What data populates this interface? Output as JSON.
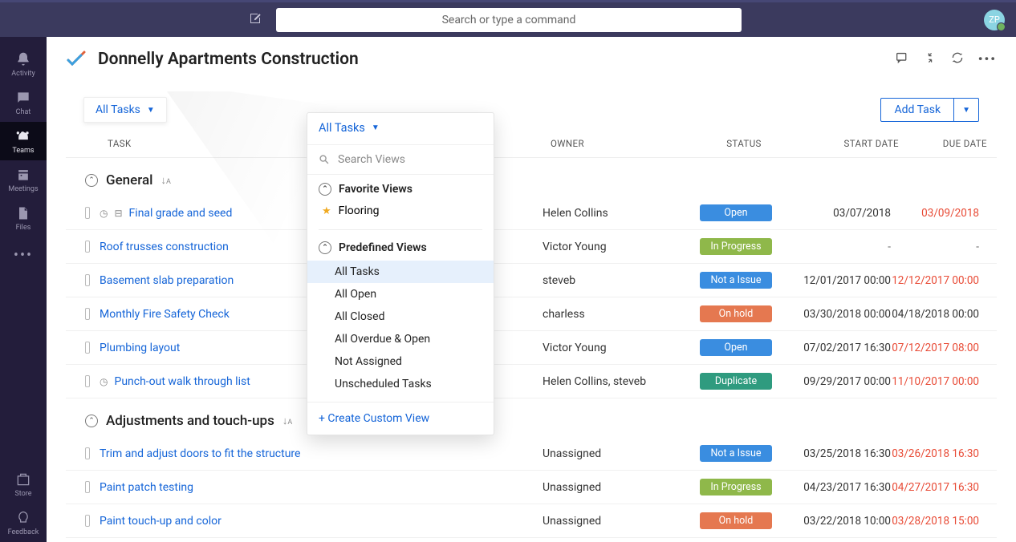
{
  "topbar": {
    "search_placeholder": "Search or type a command",
    "avatar_initials": "ZP"
  },
  "rail": {
    "activity": "Activity",
    "chat": "Chat",
    "teams": "Teams",
    "meetings": "Meetings",
    "files": "Files",
    "store": "Store",
    "feedback": "Feedback"
  },
  "header": {
    "title": "Donnelly Apartments Construction"
  },
  "toolbar": {
    "view_label": "All Tasks",
    "add_task_label": "Add Task"
  },
  "columns": {
    "task": "TASK",
    "owner": "OWNER",
    "status": "STATUS",
    "start": "START DATE",
    "due": "DUE DATE"
  },
  "sections": [
    {
      "name": "General",
      "rows": [
        {
          "title": "Final grade and seed",
          "owner": "Helen Collins",
          "status": "Open",
          "status_class": "b-open",
          "start": "03/07/2018",
          "due": "03/09/2018",
          "due_overdue": true,
          "has_clock": true,
          "has_sub": true
        },
        {
          "title": "Roof trusses construction",
          "owner": "Victor Young",
          "status": "In Progress",
          "status_class": "b-progress",
          "start": "-",
          "due": "-",
          "due_overdue": false
        },
        {
          "title": "Basement slab preparation",
          "owner": "steveb",
          "status": "Not a Issue",
          "status_class": "b-notissue",
          "start": "12/01/2017 00:00",
          "due": "12/12/2017 00:00",
          "due_overdue": true
        },
        {
          "title": "Monthly Fire Safety Check",
          "owner": "charless",
          "status": "On hold",
          "status_class": "b-hold",
          "start": "03/30/2018 00:00",
          "due": "04/18/2018 00:00",
          "due_overdue": false
        },
        {
          "title": "Plumbing layout",
          "owner": "Victor Young",
          "status": "Open",
          "status_class": "b-open",
          "start": "07/02/2017 16:30",
          "due": "07/12/2017 08:00",
          "due_overdue": true
        },
        {
          "title": "Punch-out walk through list",
          "owner": "Helen Collins, steveb",
          "status": "Duplicate",
          "status_class": "b-dup",
          "start": "09/29/2017 00:00",
          "due": "11/10/2017 00:00",
          "due_overdue": true,
          "has_clock": true
        }
      ]
    },
    {
      "name": "Adjustments and touch-ups",
      "rows": [
        {
          "title": "Trim and adjust doors to fit the structure",
          "owner": "Unassigned",
          "status": "Not a Issue",
          "status_class": "b-notissue",
          "start": "03/25/2018 16:30",
          "due": "03/26/2018 16:30",
          "due_overdue": true
        },
        {
          "title": "Paint patch testing",
          "owner": "Unassigned",
          "status": "In Progress",
          "status_class": "b-progress",
          "start": "04/23/2017 16:30",
          "due": "04/27/2017 16:30",
          "due_overdue": true
        },
        {
          "title": "Paint touch-up and color",
          "owner": "Unassigned",
          "status": "On hold",
          "status_class": "b-hold",
          "start": "03/22/2018 10:00",
          "due": "03/28/2018 15:00",
          "due_overdue": true
        }
      ]
    }
  ],
  "popout": {
    "trigger_label": "All Tasks",
    "search_placeholder": "Search Views",
    "favorite_heading": "Favorite Views",
    "favorites": [
      "Flooring"
    ],
    "predefined_heading": "Predefined Views",
    "predefined": [
      "All Tasks",
      "All Open",
      "All Closed",
      "All Overdue & Open",
      "Not Assigned",
      "Unscheduled Tasks"
    ],
    "selected": "All Tasks",
    "create_label": "+ Create Custom View"
  }
}
